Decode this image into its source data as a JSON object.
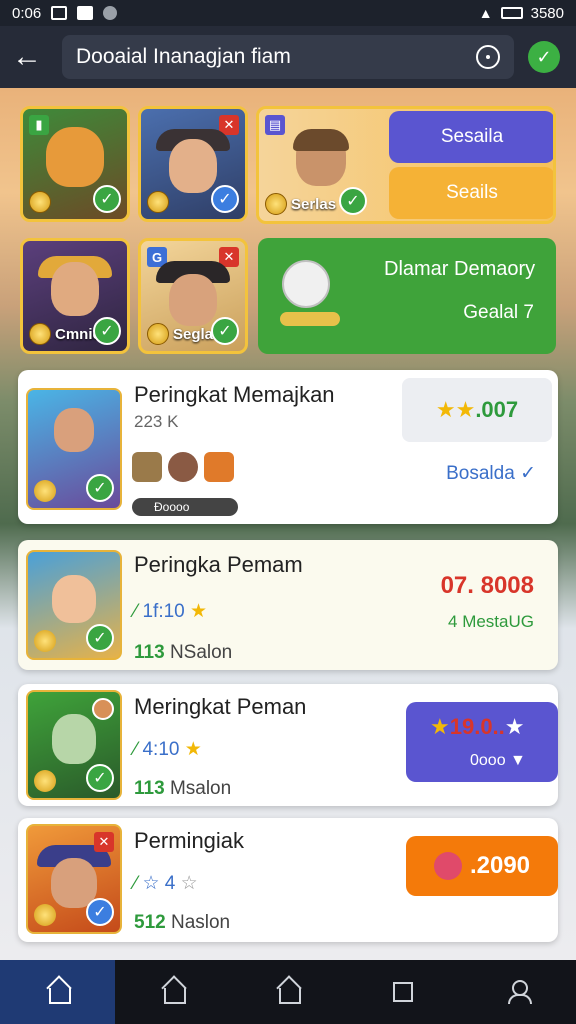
{
  "statusbar": {
    "time": "0:06",
    "right_text": "3580"
  },
  "appbar": {
    "search_value": "Dooaial Inanagjan fiam"
  },
  "featured": {
    "tiles": [
      {
        "label": ""
      },
      {
        "label": ""
      },
      {
        "label": "Serlas"
      },
      {
        "label": "Cmnie"
      },
      {
        "label": "Seglae"
      }
    ],
    "panel1": {
      "button_label": "Sesaila",
      "sub_label": "Seails"
    },
    "panel2": {
      "title": "Dlamar Demaory",
      "sub_label": "Gealal 7"
    }
  },
  "cards": [
    {
      "title": "Peringkat Memajkan",
      "sub": "223 K",
      "tag": "Ðoooo",
      "score": ".007",
      "action": "Bosalda"
    },
    {
      "title": "Peringka Pemam",
      "rating": "1f:10",
      "count": "113",
      "count_label": "NSalon",
      "score": "07. 8008",
      "sub_action": "4 MestaUG"
    },
    {
      "title": "Meringkat Peman",
      "rating": "4:10",
      "count": "113",
      "count_label": "Msalon",
      "score": "19.0..",
      "sub_action": "0ooo"
    },
    {
      "title": "Permingiak",
      "rating": "4",
      "count": "512",
      "count_label": "Naslon",
      "score": ".2090"
    }
  ],
  "colors": {
    "accent": "#5a55d0",
    "green": "#3aa542",
    "orange": "#f47a0a"
  }
}
